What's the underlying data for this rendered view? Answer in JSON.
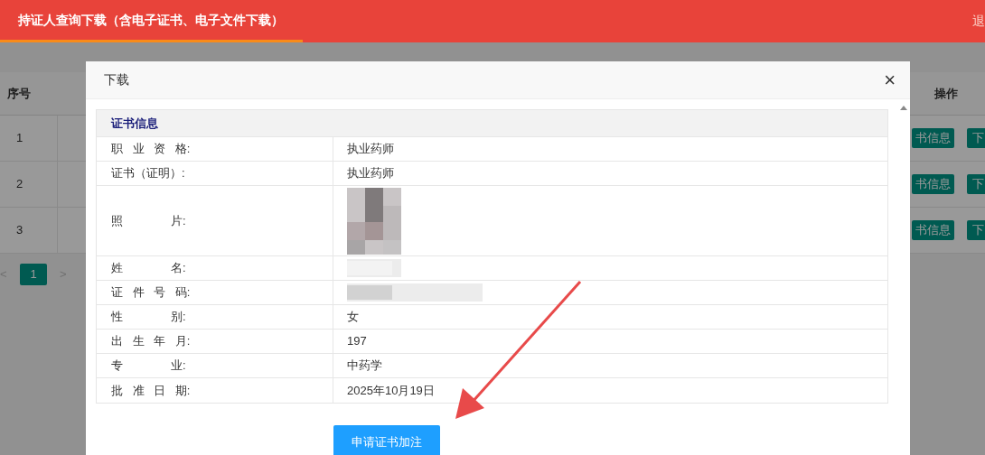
{
  "header": {
    "tab": "持证人查询下载（含电子证书、电子文件下载）",
    "right_text": "退"
  },
  "table": {
    "columns": [
      "序号",
      "操作"
    ],
    "rows": [
      {
        "index": "1",
        "buttons": [
          "书信息",
          "下"
        ]
      },
      {
        "index": "2",
        "buttons": [
          "书信息",
          "下"
        ]
      },
      {
        "index": "3",
        "buttons": [
          "书信息",
          "下"
        ]
      }
    ]
  },
  "pagination": {
    "prev": "<",
    "pages": [
      {
        "label": "1",
        "selected": true
      }
    ],
    "next": ">"
  },
  "dialog": {
    "title": "下载",
    "close": "×",
    "section": "证书信息",
    "rows": [
      {
        "label": "职 业 资 格:",
        "kind": "text",
        "value": "执业药师"
      },
      {
        "label": "证书（证明）:",
        "kind": "text",
        "value": "执业药师"
      },
      {
        "label": "照     片:",
        "kind": "picture"
      },
      {
        "label": "姓     名:",
        "kind": "redacted"
      },
      {
        "label": "证 件 号 码:",
        "kind": "redacted"
      },
      {
        "label": "性     别:",
        "kind": "text",
        "value": "女"
      },
      {
        "label": "出 生 年 月:",
        "kind": "text",
        "value": "197"
      },
      {
        "label": "专     业:",
        "kind": "text",
        "value": "中药学"
      },
      {
        "label": "批 准 日 期:",
        "kind": "text",
        "value": "2025年10月19日"
      }
    ],
    "button": "申请证书加注"
  }
}
